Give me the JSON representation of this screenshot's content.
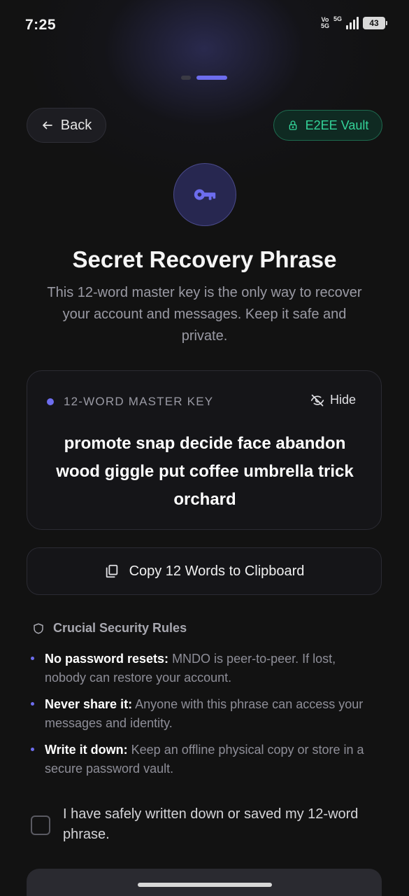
{
  "status_bar": {
    "time": "7:25",
    "volte_top": "Vo",
    "volte_bottom": "5G",
    "network": "5G",
    "battery": "43"
  },
  "pager": {
    "total": 2,
    "current": 2
  },
  "header": {
    "back_label": "Back",
    "vault_label": "E2EE Vault"
  },
  "title": "Secret Recovery Phrase",
  "subtitle": "This 12-word master key is the only way to recover your account and messages. Keep it safe and private.",
  "phrase_card": {
    "label": "12-WORD MASTER KEY",
    "hide_label": "Hide",
    "phrase": "promote snap decide face abandon wood giggle put coffee umbrella trick orchard"
  },
  "copy_button": {
    "label": "Copy 12 Words to Clipboard"
  },
  "rules": {
    "heading": "Crucial Security Rules",
    "items": [
      {
        "title": "No password resets:",
        "text": " MNDO is peer-to-peer. If lost, nobody can restore your account."
      },
      {
        "title": "Never share it:",
        "text": " Anyone with this phrase can access your messages and identity."
      },
      {
        "title": "Write it down:",
        "text": " Keep an offline physical copy or store in a secure password vault."
      }
    ]
  },
  "confirm": {
    "label": "I have safely written down or saved my 12-word phrase.",
    "checked": false
  },
  "colors": {
    "accent": "#6d6dee",
    "vault_green": "#34d399",
    "background": "#121212"
  }
}
